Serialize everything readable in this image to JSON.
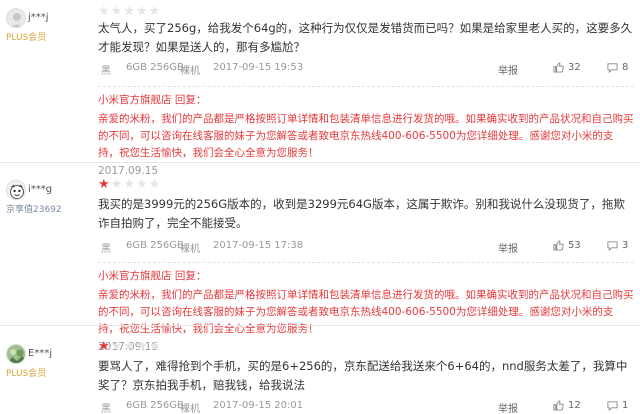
{
  "colors": {
    "star": "#e4393c",
    "reply": "#e4393c",
    "muted": "#999999",
    "plus": "#d8a73a"
  },
  "reviews": [
    {
      "user": {
        "name": "j***j",
        "level": "PLUS会员",
        "avatar_icon": "default-avatar-icon"
      },
      "stars_filled": 0,
      "text": "太气人，买了256g，给我发个64g的，这种行为仅仅是发错货而已吗？如果是给家里老人买的，这要多久才能发现？如果是送人的，那有多尴尬？",
      "meta": {
        "color": "黑",
        "spec": "6GB 256GB",
        "kind": "裸机",
        "time": "2017-09-15 19:53"
      },
      "actions": {
        "report": "举报",
        "likes": "32",
        "comments": "8"
      },
      "reply": {
        "header": "小米官方旗舰店 回复：",
        "text": "亲爱的米粉，我们的产品都是严格按照订单详情和包装清单信息进行发货的哦。如果确实收到的产品状况和自己购买的不同，可以咨询在线客服的妹子为您解答或者致电京东热线400-606-5500为您详细处理。感谢您对小米的支持，祝您生活愉快，我们会全心全意为您服务！",
        "date": "2017.09.15"
      }
    },
    {
      "user": {
        "name": "i***g",
        "level": "京享值23692",
        "avatar_icon": "cartoon-avatar-icon"
      },
      "stars_filled": 1,
      "text": "我买的是3999元的256G版本的，收到是3299元64G版本，这属于欺诈。别和我说什么没现货了，拖欺诈自拍购了，完全不能接受。",
      "meta": {
        "color": "黑",
        "spec": "6GB 256GB",
        "kind": "裸机",
        "time": "2017-09-15 17:38"
      },
      "actions": {
        "report": "举报",
        "likes": "53",
        "comments": "3"
      },
      "reply": {
        "header": "小米官方旗舰店 回复：",
        "text": "亲爱的米粉，我们的产品都是严格按照订单详情和包装清单信息进行发货的哦。如果确实收到的产品状况和自己购买的不同，可以咨询在线客服的妹子为您解答或者致电京东热线400-606-5500为您详细处理。感谢您对小米的支持，祝您生活愉快，我们会全心全意为您服务！",
        "date": "2017.09.15"
      }
    },
    {
      "user": {
        "name": "E***j",
        "level": "PLUS会员",
        "avatar_icon": "photo-avatar-icon"
      },
      "stars_filled": 1,
      "text": "要骂人了，难得抢到个手机，买的是6+256的，京东配送给我送来个6+64的，nnd服务太差了，我算中奖了？京东拍我手机，赔我钱，给我说法",
      "meta": {
        "color": "黑",
        "spec": "6GB 256GB",
        "kind": "裸机",
        "time": "2017-09-15 20:01"
      },
      "actions": {
        "report": "举报",
        "likes": "12",
        "comments": "1"
      }
    }
  ]
}
